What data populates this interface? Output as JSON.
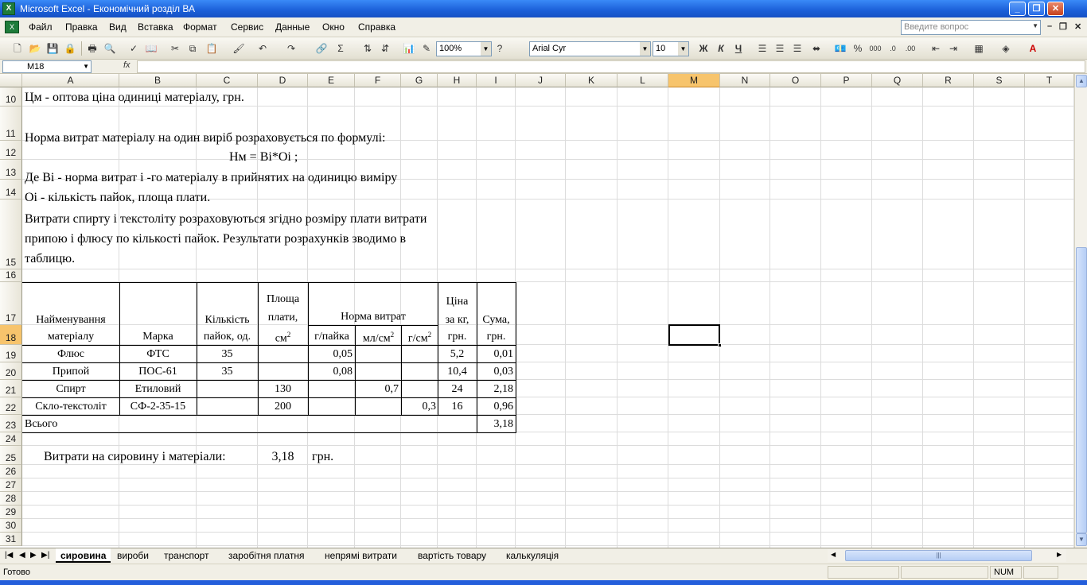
{
  "window": {
    "title": "Microsoft Excel - Економічний розділ ВА"
  },
  "menu": [
    "Файл",
    "Правка",
    "Вид",
    "Вставка",
    "Формат",
    "Сервис",
    "Данные",
    "Окно",
    "Справка"
  ],
  "help_placeholder": "Введите вопрос",
  "toolbar": {
    "zoom": "100%",
    "font": "Arial Cyr",
    "size": "10",
    "bold": "Ж",
    "italic": "К",
    "underline": "Ч"
  },
  "namebox": "M18",
  "fx_label": "fx",
  "columns": [
    "A",
    "B",
    "C",
    "D",
    "E",
    "F",
    "G",
    "H",
    "I",
    "J",
    "K",
    "L",
    "M",
    "N",
    "O",
    "P",
    "Q",
    "R",
    "S",
    "T"
  ],
  "selected_column": "M",
  "rows": [
    "10",
    "11",
    "12",
    "13",
    "14",
    "15",
    "16",
    "17",
    "18",
    "19",
    "20",
    "21",
    "22",
    "23",
    "24",
    "25",
    "26",
    "27",
    "28",
    "29",
    "30",
    "31"
  ],
  "selected_row": "18",
  "text": {
    "r10": "Цм - оптова ціна одиниці матеріалу, грн.",
    "r11": "Норма витрат матеріалу на один виріб розраховується по формулі:",
    "r12": "Нм = Ві*Оі ;",
    "r13": "Де   Ві - норма витрат  і -го матеріалу в прийнятих на одиницю виміру",
    "r14": "Оі - кількість пайок, площа плати.",
    "r15_line1": "Витрати спирту і текстоліту розраховуються згідно розміру плати витрати",
    "r15_line2": "припою і флюсу    по кількості пайок. Результати розрахунків зводимо в",
    "r15_line3": "таблицю.",
    "r25_label": "Витрати на сировину і матеріали:",
    "r25_value": "3,18",
    "r25_unit": "грн."
  },
  "table": {
    "hdr_a1": "Найменування",
    "hdr_a2": "матеріалу",
    "hdr_b": "Марка",
    "hdr_c1": "Кількість",
    "hdr_c2": "пайок, од.",
    "hdr_d1": "Площа",
    "hdr_d2": "плати,",
    "hdr_d3": "см",
    "hdr_d3_sup": "2",
    "hdr_norm": "Норма витрат",
    "hdr_e": "г/пайка",
    "hdr_f": "мл/см",
    "hdr_f_sup": "2",
    "hdr_g": "г/см",
    "hdr_g_sup": "2",
    "hdr_h1": "Ціна",
    "hdr_h2": "за кг,",
    "hdr_h3": "грн.",
    "hdr_i1": "Сума,",
    "hdr_i2": "грн.",
    "rows": [
      {
        "name": "Флюс",
        "mark": "ФТС",
        "qty": "35",
        "area": "",
        "e": "0,05",
        "f": "",
        "g": "",
        "price": "5,2",
        "sum": "0,01"
      },
      {
        "name": "Припой",
        "mark": "ПОС-61",
        "qty": "35",
        "area": "",
        "e": "0,08",
        "f": "",
        "g": "",
        "price": "10,4",
        "sum": "0,03"
      },
      {
        "name": "Спирт",
        "mark": "Етиловий",
        "qty": "",
        "area": "130",
        "e": "",
        "f": "0,7",
        "g": "",
        "price": "24",
        "sum": "2,18"
      },
      {
        "name": "Скло-текстоліт",
        "mark": "СФ-2-35-15",
        "qty": "",
        "area": "200",
        "e": "",
        "f": "",
        "g": "0,3",
        "price": "16",
        "sum": "0,96"
      }
    ],
    "total_label": "Всього",
    "total_value": "3,18"
  },
  "sheets": [
    "сировина",
    "вироби",
    "транспорт",
    "заробітня платня",
    "непрямі витрати",
    "вартість товару",
    "калькуляція"
  ],
  "active_sheet": "сировина",
  "status": {
    "text": "Готово",
    "num": "NUM"
  }
}
